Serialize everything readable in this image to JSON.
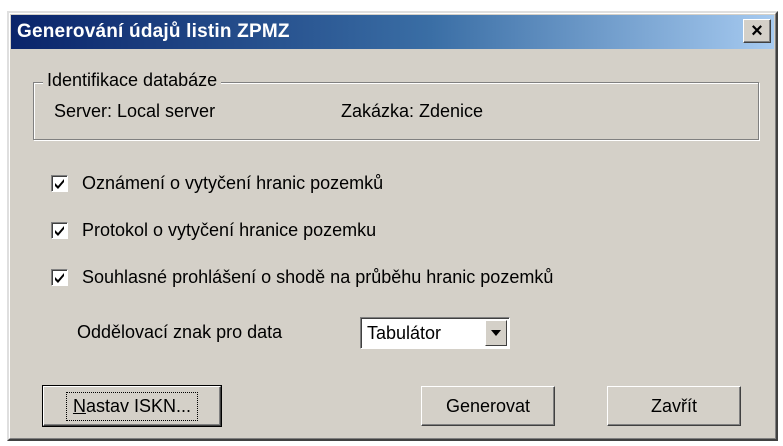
{
  "window": {
    "title": "Generování údajů listin ZPMZ",
    "close_glyph": "×"
  },
  "database_group": {
    "legend": "Identifikace databáze",
    "server_label": "Server: Local server",
    "order_label": "Zakázka: Zdenice"
  },
  "options": [
    {
      "label": "Oznámení o vytyčení hranic pozemků",
      "checked": true
    },
    {
      "label": "Protokol o vytyčení hranice pozemku",
      "checked": true
    },
    {
      "label": "Souhlasné prohlášení o shodě na průběhu hranic pozemků",
      "checked": true
    }
  ],
  "separator": {
    "label": "Oddělovací znak pro data",
    "selected": "Tabulátor",
    "arrow_icon": "triangle-down-icon"
  },
  "buttons": {
    "iskn": "Nastav ISKN...",
    "generate": "Generovat",
    "close": "Zavřít"
  },
  "colors": {
    "face": "#d4d0c8",
    "title_start": "#0a246a",
    "title_end": "#a6caf0"
  }
}
